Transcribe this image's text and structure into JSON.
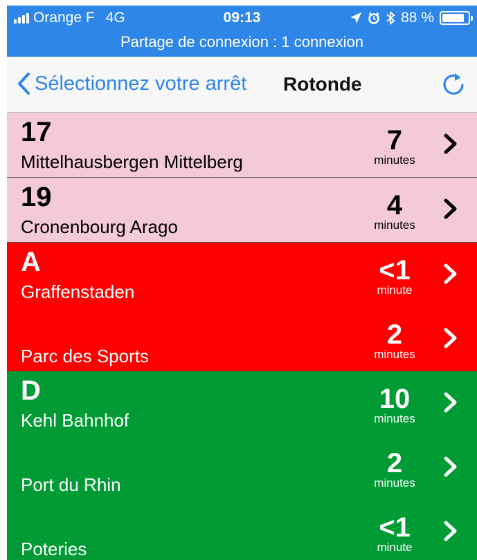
{
  "status_bar": {
    "carrier": "Orange F",
    "network": "4G",
    "time": "09:13",
    "battery": "88 %",
    "battery_level": 0.88
  },
  "hotspot_banner": "Partage de connexion : 1 connexion",
  "nav": {
    "back_label": "Sélectionnez votre arrêt",
    "title": "Rotonde"
  },
  "colors": {
    "accent": "#2f86e9",
    "line_17_19": "#f4c9da",
    "line_A": "#ff0000",
    "line_D": "#009b34"
  },
  "lines": [
    {
      "line": "17",
      "departures": [
        {
          "destination": "Mittelhausbergen Mittelberg",
          "time": "7",
          "unit": "minutes"
        }
      ]
    },
    {
      "line": "19",
      "departures": [
        {
          "destination": "Cronenbourg Arago",
          "time": "4",
          "unit": "minutes"
        }
      ]
    },
    {
      "line": "A",
      "departures": [
        {
          "destination": "Graffenstaden",
          "time": "<1",
          "unit": "minute"
        },
        {
          "destination": "Parc des Sports",
          "time": "2",
          "unit": "minutes"
        }
      ]
    },
    {
      "line": "D",
      "departures": [
        {
          "destination": "Kehl Bahnhof",
          "time": "10",
          "unit": "minutes"
        },
        {
          "destination": "Port du Rhin",
          "time": "2",
          "unit": "minutes"
        },
        {
          "destination": "Poteries",
          "time": "<1",
          "unit": "minute"
        }
      ]
    }
  ]
}
